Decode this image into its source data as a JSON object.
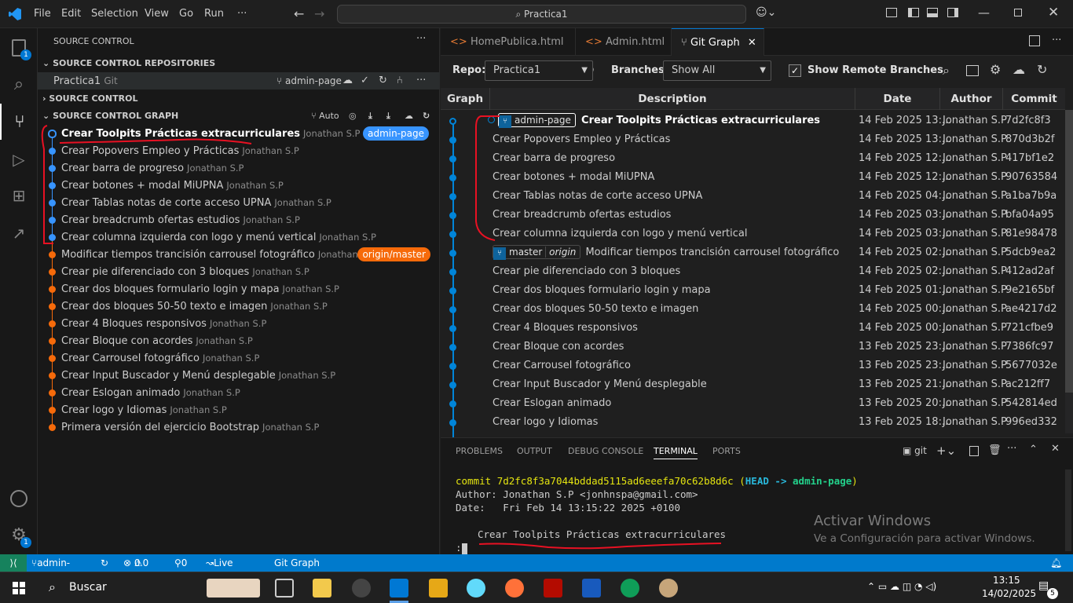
{
  "titlebar": {
    "menus": [
      "File",
      "Edit",
      "Selection",
      "View",
      "Go",
      "Run",
      "···"
    ],
    "search": "Practica1"
  },
  "activity": {
    "scm_badge": "1",
    "settings_badge": "1"
  },
  "sidebar": {
    "title": "SOURCE CONTROL",
    "repos_header": "SOURCE CONTROL REPOSITORIES",
    "repo_name": "Practica1",
    "repo_type": "Git",
    "repo_branch": "admin-page",
    "sc_header": "SOURCE CONTROL",
    "graph_header": "SOURCE CONTROL GRAPH",
    "graph_auto": "Auto",
    "commits": [
      {
        "msg": "Crear Toolpits Prácticas extracurriculares",
        "author": "Jonathan S.P",
        "tag": "admin-page"
      },
      {
        "msg": "Crear Popovers Empleo y Prácticas",
        "author": "Jonathan S.P"
      },
      {
        "msg": "Crear barra de progreso",
        "author": "Jonathan S.P"
      },
      {
        "msg": "Crear botones + modal MiUPNA",
        "author": "Jonathan S.P"
      },
      {
        "msg": "Crear Tablas notas de corte acceso UPNA",
        "author": "Jonathan S.P"
      },
      {
        "msg": "Crear breadcrumb ofertas estudios",
        "author": "Jonathan S.P"
      },
      {
        "msg": "Crear columna izquierda con logo y menú vertical",
        "author": "Jonathan S.P"
      },
      {
        "msg": "Modificar tiempos trancisión carrousel fotográfico",
        "author": "Jonathan S.P",
        "tag": "origin/master"
      },
      {
        "msg": "Crear pie diferenciado con 3 bloques",
        "author": "Jonathan S.P"
      },
      {
        "msg": "Crear dos bloques formulario login y mapa",
        "author": "Jonathan S.P"
      },
      {
        "msg": "Crear dos bloques 50-50 texto e imagen",
        "author": "Jonathan S.P"
      },
      {
        "msg": "Crear 4 Bloques responsivos",
        "author": "Jonathan S.P"
      },
      {
        "msg": "Crear Bloque con acordes",
        "author": "Jonathan S.P"
      },
      {
        "msg": "Crear Carrousel fotográfico",
        "author": "Jonathan S.P"
      },
      {
        "msg": "Crear Input Buscador y Menú desplegable",
        "author": "Jonathan S.P"
      },
      {
        "msg": "Crear Eslogan animado",
        "author": "Jonathan S.P"
      },
      {
        "msg": "Crear logo y Idiomas",
        "author": "Jonathan S.P"
      },
      {
        "msg": "Primera versión del ejercicio Bootstrap",
        "author": "Jonathan S.P"
      }
    ]
  },
  "tabs": [
    {
      "label": "HomePublica.html"
    },
    {
      "label": "Admin.html"
    },
    {
      "label": "Git Graph"
    }
  ],
  "gitgraph": {
    "repo_label": "Repo:",
    "repo": "Practica1",
    "branches_label": "Branches:",
    "branches": "Show All",
    "remote_label": "Show Remote Branches",
    "headers": [
      "Graph",
      "Description",
      "Date",
      "Author",
      "Commit"
    ],
    "ref_head": "admin-page",
    "ref_master": "master",
    "ref_origin": "origin",
    "rows": [
      {
        "desc": "Crear Toolpits Prácticas extracurriculares",
        "date": "14 Feb 2025 13:...",
        "author": "Jonathan S.P",
        "hash": "7d2fc8f3"
      },
      {
        "desc": "Crear Popovers Empleo y Prácticas",
        "date": "14 Feb 2025 13:...",
        "author": "Jonathan S.P",
        "hash": "870d3b2f"
      },
      {
        "desc": "Crear barra de progreso",
        "date": "14 Feb 2025 12:...",
        "author": "Jonathan S.P",
        "hash": "417bf1e2"
      },
      {
        "desc": "Crear botones + modal MiUPNA",
        "date": "14 Feb 2025 12:...",
        "author": "Jonathan S.P",
        "hash": "90763584"
      },
      {
        "desc": "Crear Tablas notas de corte acceso UPNA",
        "date": "14 Feb 2025 04:...",
        "author": "Jonathan S.P",
        "hash": "a1ba7b9a"
      },
      {
        "desc": "Crear breadcrumb ofertas estudios",
        "date": "14 Feb 2025 03:...",
        "author": "Jonathan S.P",
        "hash": "bfa04a95"
      },
      {
        "desc": "Crear columna izquierda con logo y menú vertical",
        "date": "14 Feb 2025 03:...",
        "author": "Jonathan S.P",
        "hash": "81e98478"
      },
      {
        "desc": "Modificar tiempos trancisión carrousel fotográfico",
        "date": "14 Feb 2025 02:...",
        "author": "Jonathan S.P",
        "hash": "5dcb9ea2"
      },
      {
        "desc": "Crear pie diferenciado con 3 bloques",
        "date": "14 Feb 2025 02:...",
        "author": "Jonathan S.P",
        "hash": "412ad2af"
      },
      {
        "desc": "Crear dos bloques formulario login y mapa",
        "date": "14 Feb 2025 01:...",
        "author": "Jonathan S.P",
        "hash": "9e2165bf"
      },
      {
        "desc": "Crear dos bloques 50-50 texto e imagen",
        "date": "14 Feb 2025 00:...",
        "author": "Jonathan S.P",
        "hash": "ae4217d2"
      },
      {
        "desc": "Crear 4 Bloques responsivos",
        "date": "14 Feb 2025 00:...",
        "author": "Jonathan S.P",
        "hash": "721cfbe9"
      },
      {
        "desc": "Crear Bloque con acordes",
        "date": "13 Feb 2025 23:...",
        "author": "Jonathan S.P",
        "hash": "7386fc97"
      },
      {
        "desc": "Crear Carrousel fotográfico",
        "date": "13 Feb 2025 23:...",
        "author": "Jonathan S.P",
        "hash": "5677032e"
      },
      {
        "desc": "Crear Input Buscador y Menú desplegable",
        "date": "13 Feb 2025 21:...",
        "author": "Jonathan S.P",
        "hash": "ac212ff7"
      },
      {
        "desc": "Crear Eslogan animado",
        "date": "13 Feb 2025 20:...",
        "author": "Jonathan S.P",
        "hash": "542814ed"
      },
      {
        "desc": "Crear logo y Idiomas",
        "date": "13 Feb 2025 18:...",
        "author": "Jonathan S.P",
        "hash": "996ed332"
      }
    ]
  },
  "panel": {
    "tabs": [
      "PROBLEMS",
      "OUTPUT",
      "DEBUG CONSOLE",
      "TERMINAL",
      "PORTS"
    ],
    "shell": "git",
    "commit_word": "commit",
    "commit_hash": "7d2fc8f3a7044bddad5115ad6eeefa70c62b8d6c",
    "head": "HEAD",
    "arrow": "->",
    "branch": "admin-page",
    "author_line": "Author: Jonathan S.P <jonhnspa@gmail.com>",
    "date_line": "Date:   Fri Feb 14 13:15:22 2025 +0100",
    "message": "Crear Toolpits Prácticas extracurriculares",
    "prompt": ":",
    "activate_title": "Activar Windows",
    "activate_sub": "Ve a Configuración para activar Windows."
  },
  "statusbar": {
    "branch": "admin-page",
    "problems": "0",
    "warnings": "0",
    "ports": "0",
    "liveshare": "Live Share",
    "gitgraph": "Git Graph"
  },
  "taskbar": {
    "search": "Buscar",
    "time": "13:15",
    "date": "14/02/2025",
    "notif": "5"
  }
}
